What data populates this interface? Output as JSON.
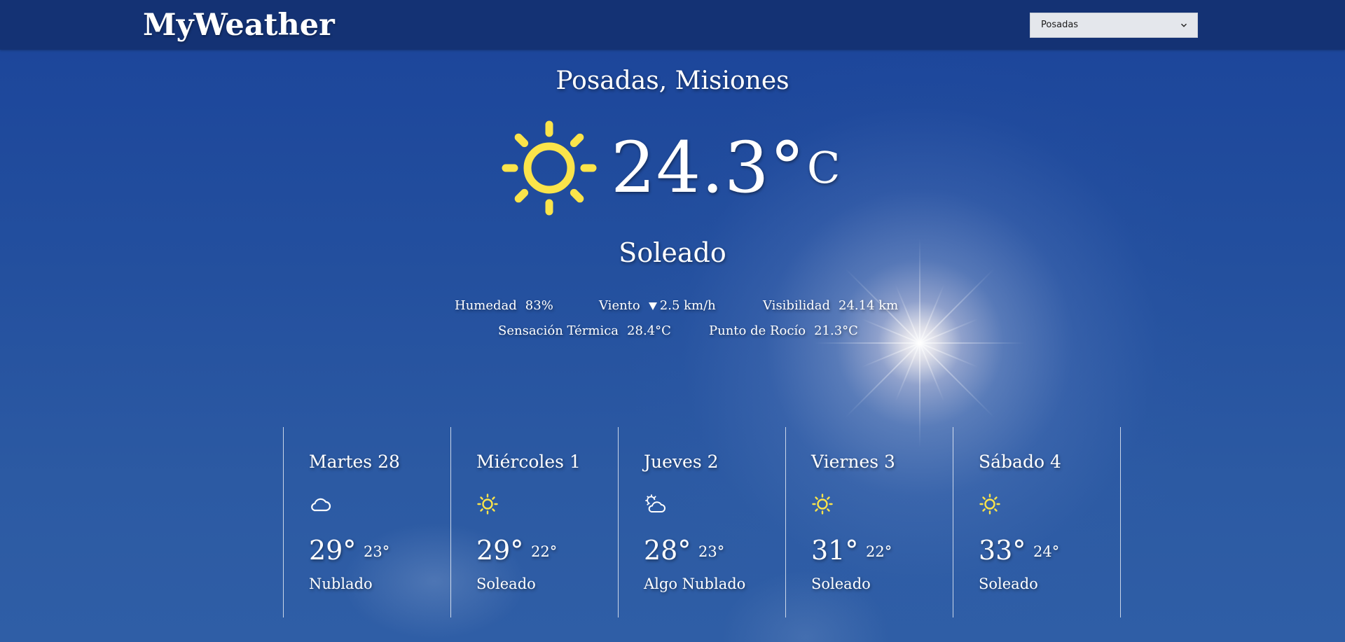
{
  "header": {
    "logo": "MyWeather",
    "city_select": {
      "selected": "Posadas"
    }
  },
  "current": {
    "location": "Posadas, Misiones",
    "icon": "sun-icon",
    "temperature": "24.3°",
    "unit": "C",
    "condition": "Soleado",
    "details": {
      "humidity": {
        "label": "Humedad",
        "value": "83%"
      },
      "wind": {
        "label": "Viento",
        "value": "2.5 km/h",
        "direction_icon": "wind-direction-arrow-icon"
      },
      "visibility": {
        "label": "Visibilidad",
        "value": "24.14 km"
      },
      "feels_like": {
        "label": "Sensación Térmica",
        "value": "28.4°C"
      },
      "dew_point": {
        "label": "Punto de Rocío",
        "value": "21.3°C"
      }
    }
  },
  "forecast": [
    {
      "day": "Martes 28",
      "icon": "cloud-icon",
      "high": "29°",
      "low": "23°",
      "condition": "Nublado"
    },
    {
      "day": "Miércoles 1",
      "icon": "sun-icon",
      "high": "29°",
      "low": "22°",
      "condition": "Soleado"
    },
    {
      "day": "Jueves 2",
      "icon": "partly-cloudy-icon",
      "high": "28°",
      "low": "23°",
      "condition": "Algo Nublado"
    },
    {
      "day": "Viernes 3",
      "icon": "sun-icon",
      "high": "31°",
      "low": "22°",
      "condition": "Soleado"
    },
    {
      "day": "Sábado 4",
      "icon": "sun-icon",
      "high": "33°",
      "low": "24°",
      "condition": "Soleado"
    }
  ],
  "colors": {
    "header_background": "#143274",
    "sky_background": "#234f9e",
    "sun_icon": "#fbe44a",
    "text": "#ffffff"
  }
}
